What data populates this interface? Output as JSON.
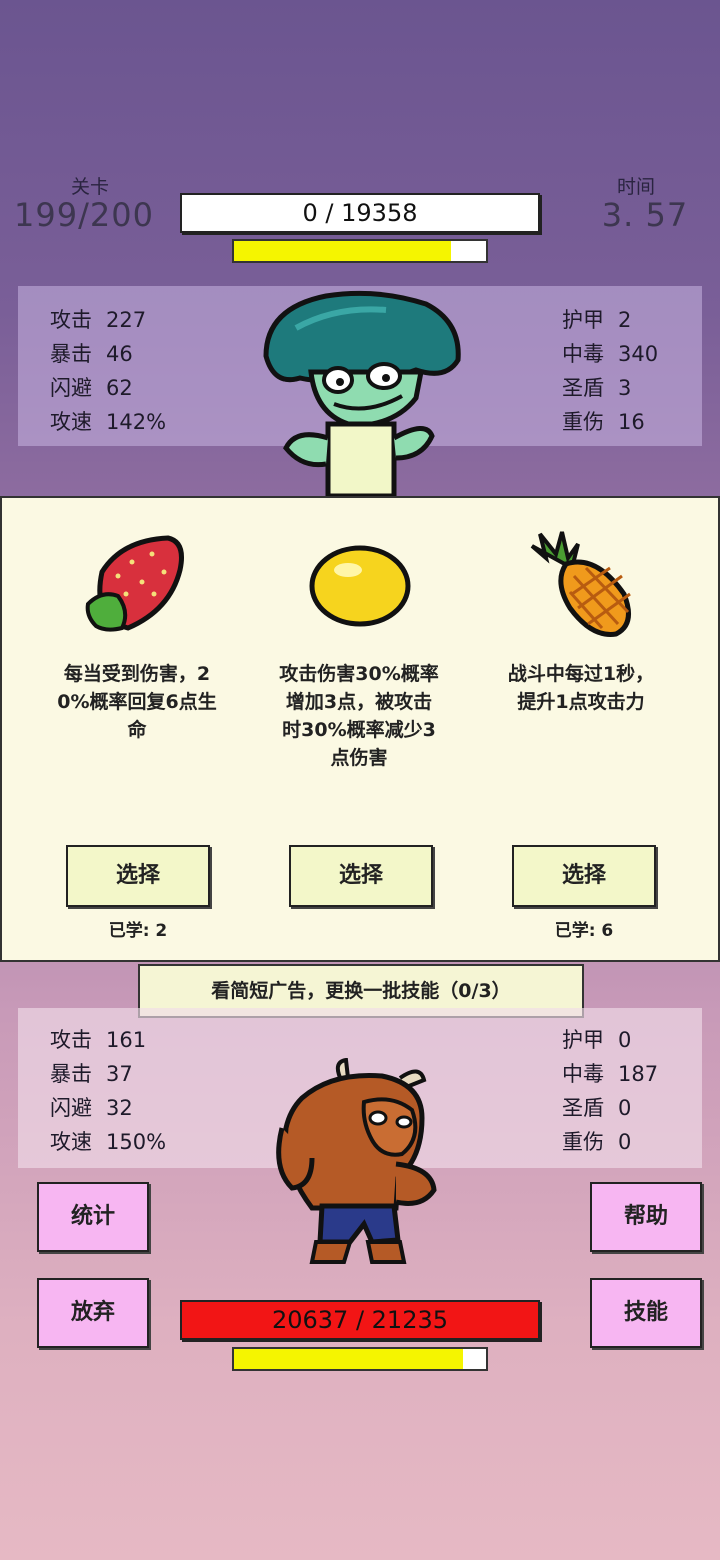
{
  "header": {
    "level_label": "关卡",
    "level_value": "199/200",
    "time_label": "时间",
    "time_value": "3. 57",
    "enemy_hp": "0  /  19358",
    "enemy_energy_pct": 0.86
  },
  "enemy_stats": {
    "left": [
      {
        "name": "攻击",
        "value": "227"
      },
      {
        "name": "暴击",
        "value": "46"
      },
      {
        "name": "闪避",
        "value": "62"
      },
      {
        "name": "攻速",
        "value": "142%"
      }
    ],
    "right": [
      {
        "name": "护甲",
        "value": "2"
      },
      {
        "name": "中毒",
        "value": "340"
      },
      {
        "name": "圣盾",
        "value": "3"
      },
      {
        "name": "重伤",
        "value": "16"
      }
    ]
  },
  "skills": [
    {
      "icon": "strawberry-icon",
      "desc_lines": [
        "每当受到伤害，2",
        "0%概率回复6点生",
        "命"
      ],
      "button": "选择",
      "learned": "已学: 2"
    },
    {
      "icon": "lemon-icon",
      "desc_lines": [
        "攻击伤害30%概率",
        "增加3点，被攻击",
        "时30%概率减少3",
        "点伤害"
      ],
      "button": "选择",
      "learned": ""
    },
    {
      "icon": "pineapple-icon",
      "desc_lines": [
        "战斗中每过1秒，",
        "提升1点攻击力"
      ],
      "button": "选择",
      "learned": "已学: 6"
    }
  ],
  "ad_button": "看简短广告，更换一批技能（0/3）",
  "player_stats": {
    "left": [
      {
        "name": "攻击",
        "value": "161"
      },
      {
        "name": "暴击",
        "value": "37"
      },
      {
        "name": "闪避",
        "value": "32"
      },
      {
        "name": "攻速",
        "value": "150%"
      }
    ],
    "right": [
      {
        "name": "护甲",
        "value": "0"
      },
      {
        "name": "中毒",
        "value": "187"
      },
      {
        "name": "圣盾",
        "value": "0"
      },
      {
        "name": "重伤",
        "value": "0"
      }
    ]
  },
  "buttons": {
    "stats": "统计",
    "help": "帮助",
    "give_up": "放弃",
    "skills": "技能"
  },
  "player_hp": "20637  /  21235",
  "player_energy_pct": 0.91,
  "colors": {
    "hp_bar_red": "#f21515",
    "energy_yellow": "#f5f500",
    "pink_button": "#f7b6f2",
    "card_bg": "#fbf9e3"
  }
}
